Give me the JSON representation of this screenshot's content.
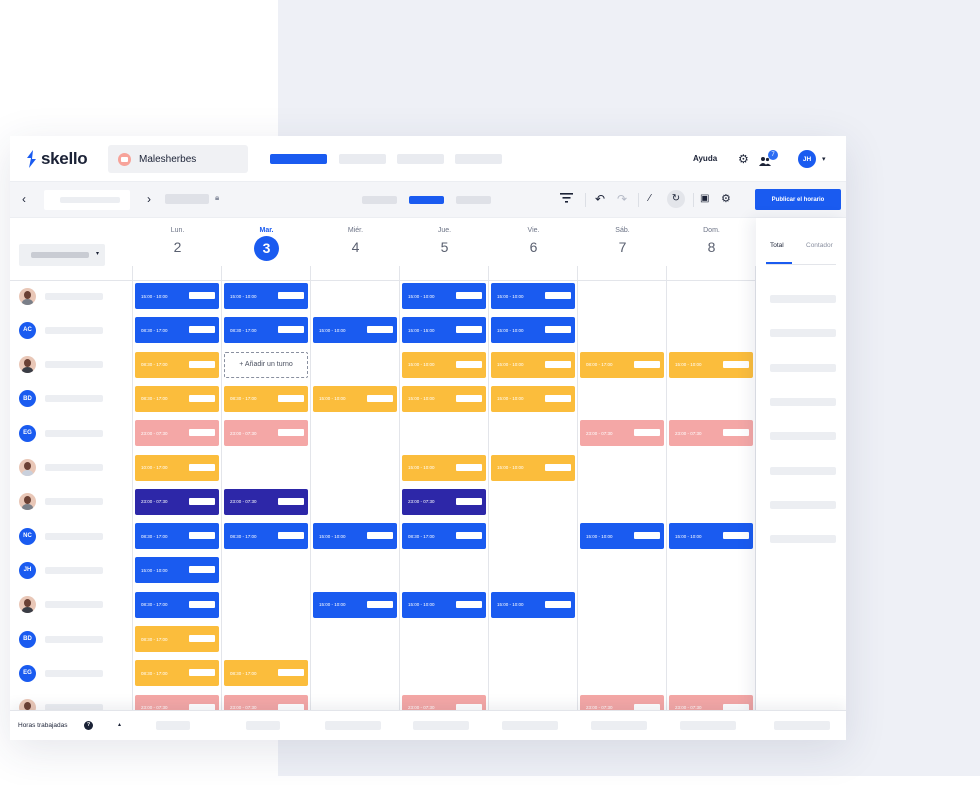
{
  "colors": {
    "blue": "#1a5bf0",
    "yellow": "#fbbd3c",
    "pink": "#f4a7a6",
    "navy": "#2d27a8"
  },
  "topbar": {
    "logo_text": "skello",
    "shop_name": "Malesherbes",
    "help_label": "Ayuda",
    "settings_icon": "gear-icon",
    "notifications_icon": "users-icon",
    "notification_count": "7",
    "user_initials": "JH"
  },
  "toolbar": {
    "publish_label": "Publicar el horario"
  },
  "days": [
    {
      "name": "Lun.",
      "num": "2",
      "today": false
    },
    {
      "name": "Mar.",
      "num": "3",
      "today": true
    },
    {
      "name": "Miér.",
      "num": "4",
      "today": false
    },
    {
      "name": "Jue.",
      "num": "5",
      "today": false
    },
    {
      "name": "Vie.",
      "num": "6",
      "today": false
    },
    {
      "name": "Sáb.",
      "num": "7",
      "today": false
    },
    {
      "name": "Dom.",
      "num": "8",
      "today": false
    }
  ],
  "employees": [
    {
      "initials": "",
      "photo": true
    },
    {
      "initials": "AC",
      "photo": false
    },
    {
      "initials": "",
      "photo": true
    },
    {
      "initials": "BD",
      "photo": false
    },
    {
      "initials": "EG",
      "photo": false
    },
    {
      "initials": "",
      "photo": true
    },
    {
      "initials": "",
      "photo": true
    },
    {
      "initials": "NC",
      "photo": false
    },
    {
      "initials": "JH",
      "photo": false
    },
    {
      "initials": "",
      "photo": true
    },
    {
      "initials": "BD",
      "photo": false
    },
    {
      "initials": "EG",
      "photo": false
    },
    {
      "initials": "",
      "photo": true
    }
  ],
  "shifts": [
    {
      "row": 0,
      "day": 0,
      "color": "blue",
      "time": "15:00 - 10:00"
    },
    {
      "row": 0,
      "day": 1,
      "color": "blue",
      "time": "15:00 - 10:00"
    },
    {
      "row": 0,
      "day": 3,
      "color": "blue",
      "time": "15:00 - 10:00"
    },
    {
      "row": 0,
      "day": 4,
      "color": "blue",
      "time": "15:00 - 10:00"
    },
    {
      "row": 1,
      "day": 0,
      "color": "blue",
      "time": "08:30 - 17:00"
    },
    {
      "row": 1,
      "day": 1,
      "color": "blue",
      "time": "08:30 - 17:00"
    },
    {
      "row": 1,
      "day": 2,
      "color": "blue",
      "time": "15:00 - 10:00"
    },
    {
      "row": 1,
      "day": 3,
      "color": "blue",
      "time": "15:00 - 15:00"
    },
    {
      "row": 1,
      "day": 4,
      "color": "blue",
      "time": "15:00 - 10:00"
    },
    {
      "row": 2,
      "day": 0,
      "color": "yellow",
      "time": "08:30 - 17:00"
    },
    {
      "row": 2,
      "day": 3,
      "color": "yellow",
      "time": "15:00 - 10:00"
    },
    {
      "row": 2,
      "day": 4,
      "color": "yellow",
      "time": "15:00 - 10:00"
    },
    {
      "row": 2,
      "day": 5,
      "color": "yellow",
      "time": "08:00 - 17:00"
    },
    {
      "row": 2,
      "day": 6,
      "color": "yellow",
      "time": "15:00 - 10:00"
    },
    {
      "row": 3,
      "day": 0,
      "color": "yellow",
      "time": "08:30 - 17:00"
    },
    {
      "row": 3,
      "day": 1,
      "color": "yellow",
      "time": "08:30 - 17:00"
    },
    {
      "row": 3,
      "day": 2,
      "color": "yellow",
      "time": "15:00 - 10:00"
    },
    {
      "row": 3,
      "day": 3,
      "color": "yellow",
      "time": "15:00 - 10:00"
    },
    {
      "row": 3,
      "day": 4,
      "color": "yellow",
      "time": "15:00 - 10:00"
    },
    {
      "row": 4,
      "day": 0,
      "color": "pink",
      "time": "23:00 - 07:30"
    },
    {
      "row": 4,
      "day": 1,
      "color": "pink",
      "time": "23:00 - 07:30"
    },
    {
      "row": 4,
      "day": 5,
      "color": "pink",
      "time": "23:00 - 07:30"
    },
    {
      "row": 4,
      "day": 6,
      "color": "pink",
      "time": "23:00 - 07:30"
    },
    {
      "row": 5,
      "day": 0,
      "color": "yellow",
      "time": "10:00 - 17:00"
    },
    {
      "row": 5,
      "day": 3,
      "color": "yellow",
      "time": "15:00 - 10:00"
    },
    {
      "row": 5,
      "day": 4,
      "color": "yellow",
      "time": "15:00 - 10:00"
    },
    {
      "row": 6,
      "day": 0,
      "color": "navy",
      "time": "23:00 - 07:30"
    },
    {
      "row": 6,
      "day": 1,
      "color": "navy",
      "time": "23:00 - 07:30"
    },
    {
      "row": 6,
      "day": 3,
      "color": "navy",
      "time": "23:00 - 07:30"
    },
    {
      "row": 7,
      "day": 0,
      "color": "blue",
      "time": "08:30 - 17:00"
    },
    {
      "row": 7,
      "day": 1,
      "color": "blue",
      "time": "08:30 - 17:00"
    },
    {
      "row": 7,
      "day": 2,
      "color": "blue",
      "time": "15:00 - 10:00"
    },
    {
      "row": 7,
      "day": 3,
      "color": "blue",
      "time": "08:30 - 17:00"
    },
    {
      "row": 7,
      "day": 5,
      "color": "blue",
      "time": "15:00 - 10:00"
    },
    {
      "row": 7,
      "day": 6,
      "color": "blue",
      "time": "15:00 - 10:00"
    },
    {
      "row": 8,
      "day": 0,
      "color": "blue",
      "time": "15:00 - 10:00"
    },
    {
      "row": 9,
      "day": 0,
      "color": "blue",
      "time": "08:30 - 17:00"
    },
    {
      "row": 9,
      "day": 2,
      "color": "blue",
      "time": "15:00 - 10:00"
    },
    {
      "row": 9,
      "day": 3,
      "color": "blue",
      "time": "15:00 - 10:00"
    },
    {
      "row": 9,
      "day": 4,
      "color": "blue",
      "time": "15:00 - 10:00"
    },
    {
      "row": 10,
      "day": 0,
      "color": "yellow",
      "time": "08:30 - 17:00"
    },
    {
      "row": 11,
      "day": 0,
      "color": "yellow",
      "time": "08:30 - 17:00"
    },
    {
      "row": 11,
      "day": 1,
      "color": "yellow",
      "time": "08:30 - 17:00"
    },
    {
      "row": 12,
      "day": 0,
      "color": "pink",
      "time": "23:00 - 07:30"
    },
    {
      "row": 12,
      "day": 1,
      "color": "pink",
      "time": "23:00 - 07:30"
    },
    {
      "row": 12,
      "day": 3,
      "color": "pink",
      "time": "23:00 - 07:30"
    },
    {
      "row": 12,
      "day": 5,
      "color": "pink",
      "time": "23:00 - 07:30"
    },
    {
      "row": 12,
      "day": 6,
      "color": "pink",
      "time": "23:00 - 07:30"
    }
  ],
  "add_shift": {
    "row": 2,
    "day": 1,
    "label": "+ Añadir un turno"
  },
  "right_panel": {
    "tab_total": "Total",
    "tab_counter": "Contador"
  },
  "footer": {
    "label": "Horas trabajadas",
    "help_icon": "question-icon"
  }
}
